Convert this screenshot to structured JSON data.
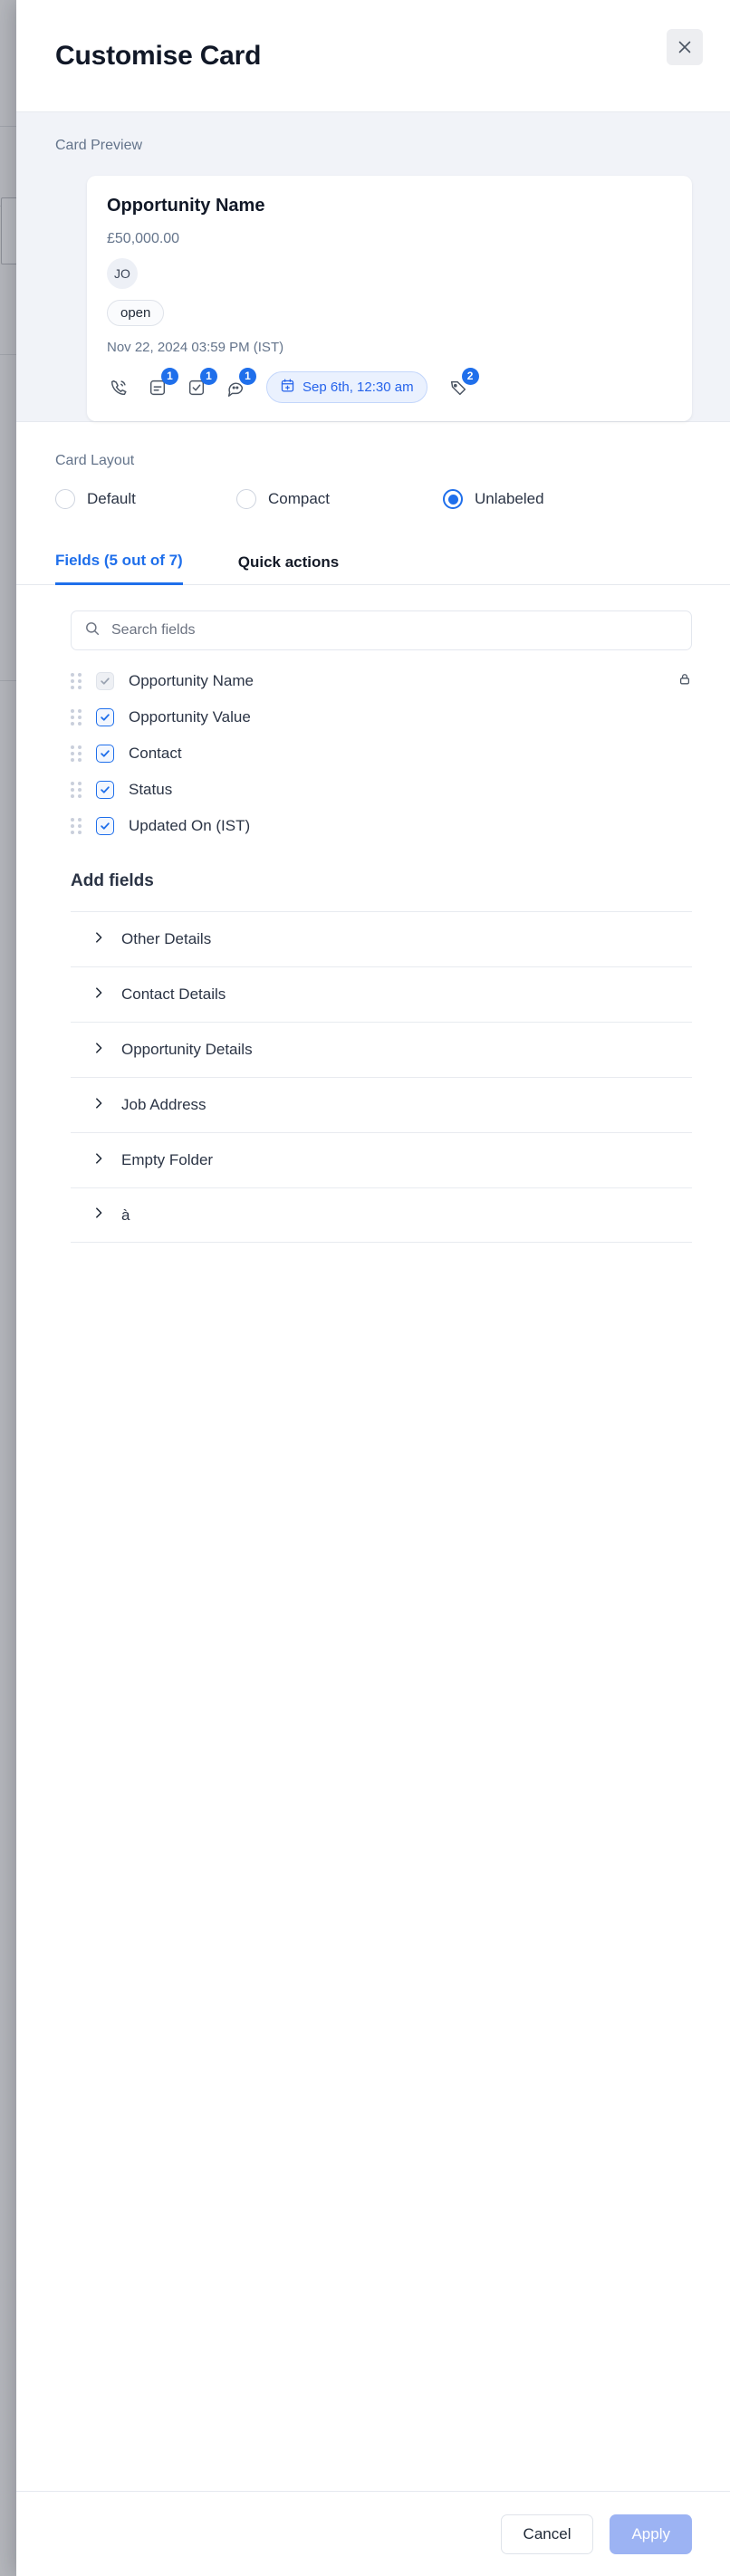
{
  "header": {
    "title": "Customise Card",
    "close_icon": "close-icon"
  },
  "preview": {
    "label": "Card Preview",
    "card": {
      "title": "Opportunity Name",
      "value": "£50,000.00",
      "avatar_initials": "JO",
      "status": "open",
      "updated_on": "Nov 22, 2024 03:59 PM (IST)",
      "action_icons": [
        {
          "icon": "phone-icon",
          "badge": ""
        },
        {
          "icon": "note-icon",
          "badge": "1"
        },
        {
          "icon": "task-icon",
          "badge": "1"
        },
        {
          "icon": "comment-icon",
          "badge": "1"
        }
      ],
      "date_chip": {
        "icon": "calendar-plus-icon",
        "text": "Sep 6th, 12:30 am"
      },
      "tag_icon": {
        "icon": "tag-icon",
        "badge": "2"
      }
    }
  },
  "card_layout": {
    "label": "Card Layout",
    "options": [
      {
        "label": "Default",
        "selected": false
      },
      {
        "label": "Compact",
        "selected": false
      },
      {
        "label": "Unlabeled",
        "selected": true
      }
    ]
  },
  "tabs": [
    {
      "label": "Fields (5 out of 7)",
      "active": true
    },
    {
      "label": "Quick actions",
      "active": false
    }
  ],
  "search": {
    "placeholder": "Search fields",
    "value": "",
    "icon": "search-icon"
  },
  "fields": [
    {
      "label": "Opportunity Name",
      "checked": true,
      "locked": true
    },
    {
      "label": "Opportunity Value",
      "checked": true,
      "locked": false
    },
    {
      "label": "Contact",
      "checked": true,
      "locked": false
    },
    {
      "label": "Status",
      "checked": true,
      "locked": false
    },
    {
      "label": "Updated On (IST)",
      "checked": true,
      "locked": false
    }
  ],
  "add_fields": {
    "title": "Add fields",
    "folders": [
      {
        "label": "Other Details"
      },
      {
        "label": "Contact Details"
      },
      {
        "label": "Opportunity Details"
      },
      {
        "label": "Job Address"
      },
      {
        "label": "Empty Folder"
      },
      {
        "label": "à"
      }
    ]
  },
  "footer": {
    "cancel_label": "Cancel",
    "apply_label": "Apply"
  },
  "colors": {
    "accent": "#1f6feb",
    "apply_disabled": "#9cb3f3",
    "panel_bg": "#f1f3f8",
    "text": "#2b3445",
    "muted": "#64748b"
  }
}
